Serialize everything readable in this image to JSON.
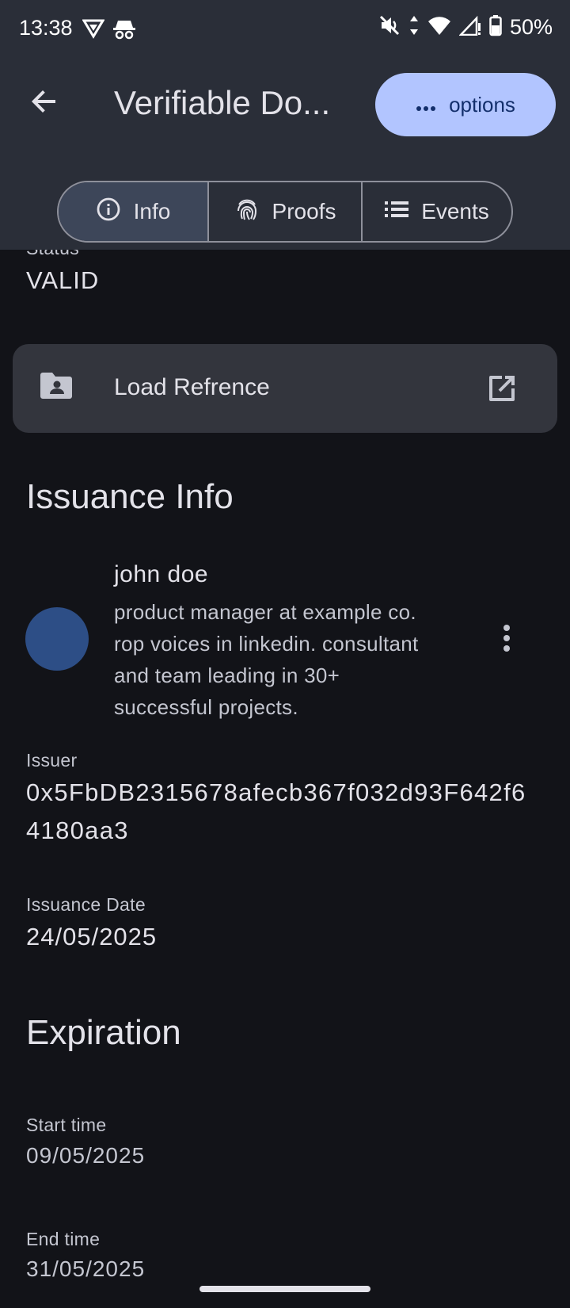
{
  "status_bar": {
    "time": "13:38",
    "battery": "50%"
  },
  "app_bar": {
    "title": "Verifiable Do...",
    "options_label": "options"
  },
  "tabs": [
    {
      "label": "Info",
      "icon": "info-icon",
      "active": true
    },
    {
      "label": "Proofs",
      "icon": "fingerprint-icon",
      "active": false
    },
    {
      "label": "Events",
      "icon": "list-icon",
      "active": false
    }
  ],
  "status": {
    "label": "Status",
    "value": "VALID"
  },
  "reference": {
    "label": "Load Refrence",
    "icon": "folder-shared-icon",
    "action_icon": "open-in-new-icon"
  },
  "issuance": {
    "heading": "Issuance Info",
    "issuer_profile": {
      "name": "john doe",
      "description": "product manager at example co. rop voices in linkedin. consultant and team leading in 30+ successful projects."
    },
    "issuer_label": "Issuer",
    "issuer_value": "0x5FbDB2315678afecb367f032d93F642f64180aa3",
    "date_label": "Issuance Date",
    "date_value": "24/05/2025"
  },
  "expiration": {
    "heading": "Expiration",
    "start_label": "Start time",
    "start_value": "09/05/2025",
    "end_label": "End time",
    "end_value": "31/05/2025"
  },
  "colors": {
    "options_bg": "#b2c5ff",
    "avatar": "#2d4e86",
    "topbar": "#2a2e38",
    "background": "#121318"
  }
}
